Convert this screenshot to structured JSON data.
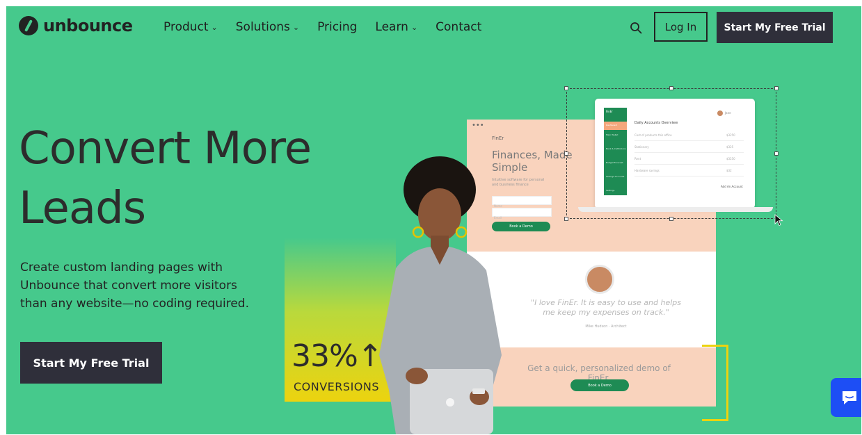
{
  "header": {
    "logo_text": "unbounce",
    "nav": [
      {
        "label": "Product",
        "has_dropdown": true
      },
      {
        "label": "Solutions",
        "has_dropdown": true
      },
      {
        "label": "Pricing",
        "has_dropdown": false
      },
      {
        "label": "Learn",
        "has_dropdown": true
      },
      {
        "label": "Contact",
        "has_dropdown": false
      }
    ],
    "login_label": "Log In",
    "trial_label": "Start My Free Trial"
  },
  "hero": {
    "headline_line1": "Convert More",
    "headline_line2": "Leads",
    "subcopy": "Create custom landing pages with Unbounce that convert more visitors than any website—no coding required.",
    "cta_label": "Start My Free Trial",
    "conversion_value": "33%↑",
    "conversion_label": "CONVERSIONS"
  },
  "mock_landing_page": {
    "brand": "FinEr",
    "title": "Finances, Made Simple",
    "description": "Intuitive software for personal and business finance",
    "input1": "Name",
    "input2": "Email",
    "button1": "Book a Demo",
    "quote": "\"I love FinEr. It is easy to use and helps me keep my expenses on track.\"",
    "cite": "Mike Hudson · Architect",
    "demo_text": "Get a quick, personalized demo of FinEr.",
    "button2": "Book a Demo"
  },
  "mock_laptop": {
    "brand": "FinEr",
    "title": "Daily Accounts Overview",
    "user": "Jane",
    "sidebar_items": [
      "Dashboard",
      "Main Wallet",
      "Bank & Institutions",
      "Budget Forecast",
      "Savings Accounts",
      "Settings"
    ],
    "rows": [
      {
        "label": "Cost of products this office",
        "value": "$3250"
      },
      {
        "label": "Stationary",
        "value": "$325"
      },
      {
        "label": "Rent",
        "value": "$3250"
      },
      {
        "label": "Hardware savings",
        "value": "$32"
      }
    ],
    "link": "Add An Account"
  },
  "icons": {
    "search": "search-icon",
    "chat": "chat-icon",
    "cursor": "cursor-arrow-icon"
  },
  "colors": {
    "hero_bg": "#46c98c",
    "dark_button": "#2f2f3a",
    "accent_green": "#1e8b54",
    "peach": "#f9d3bd",
    "yellow": "#ecd30f",
    "chat_blue": "#1d4ef5"
  }
}
